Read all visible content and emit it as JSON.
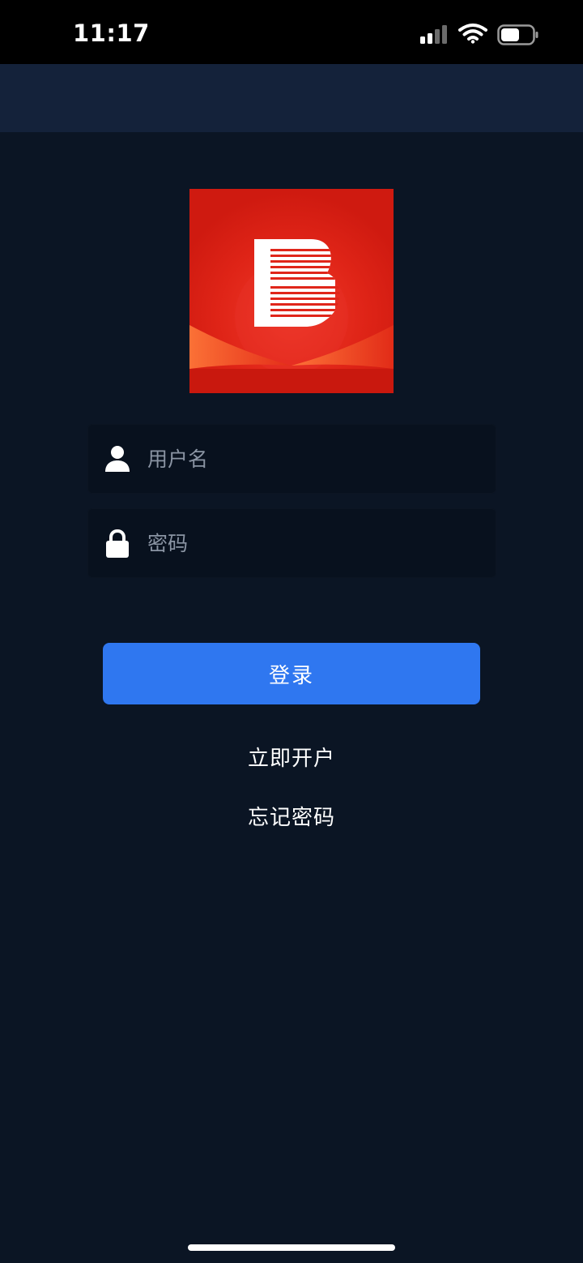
{
  "status_bar": {
    "time": "11:17",
    "icons": [
      "signal-icon",
      "wifi-icon",
      "battery-icon"
    ]
  },
  "logo": {
    "letter": "B",
    "icon": "brand-logo"
  },
  "login_form": {
    "username": {
      "placeholder": "用户名",
      "value": "",
      "icon": "user-icon"
    },
    "password": {
      "placeholder": "密码",
      "value": "",
      "icon": "lock-icon"
    },
    "login_label": "登录"
  },
  "links": {
    "open_account": "立即开户",
    "forgot_password": "忘记密码"
  },
  "colors": {
    "background": "#0b1524",
    "nav_bar": "#14223a",
    "input_background": "#08111e",
    "primary_button": "#2f77f0",
    "logo_red": "#d91f14",
    "placeholder": "#8a94a3"
  }
}
